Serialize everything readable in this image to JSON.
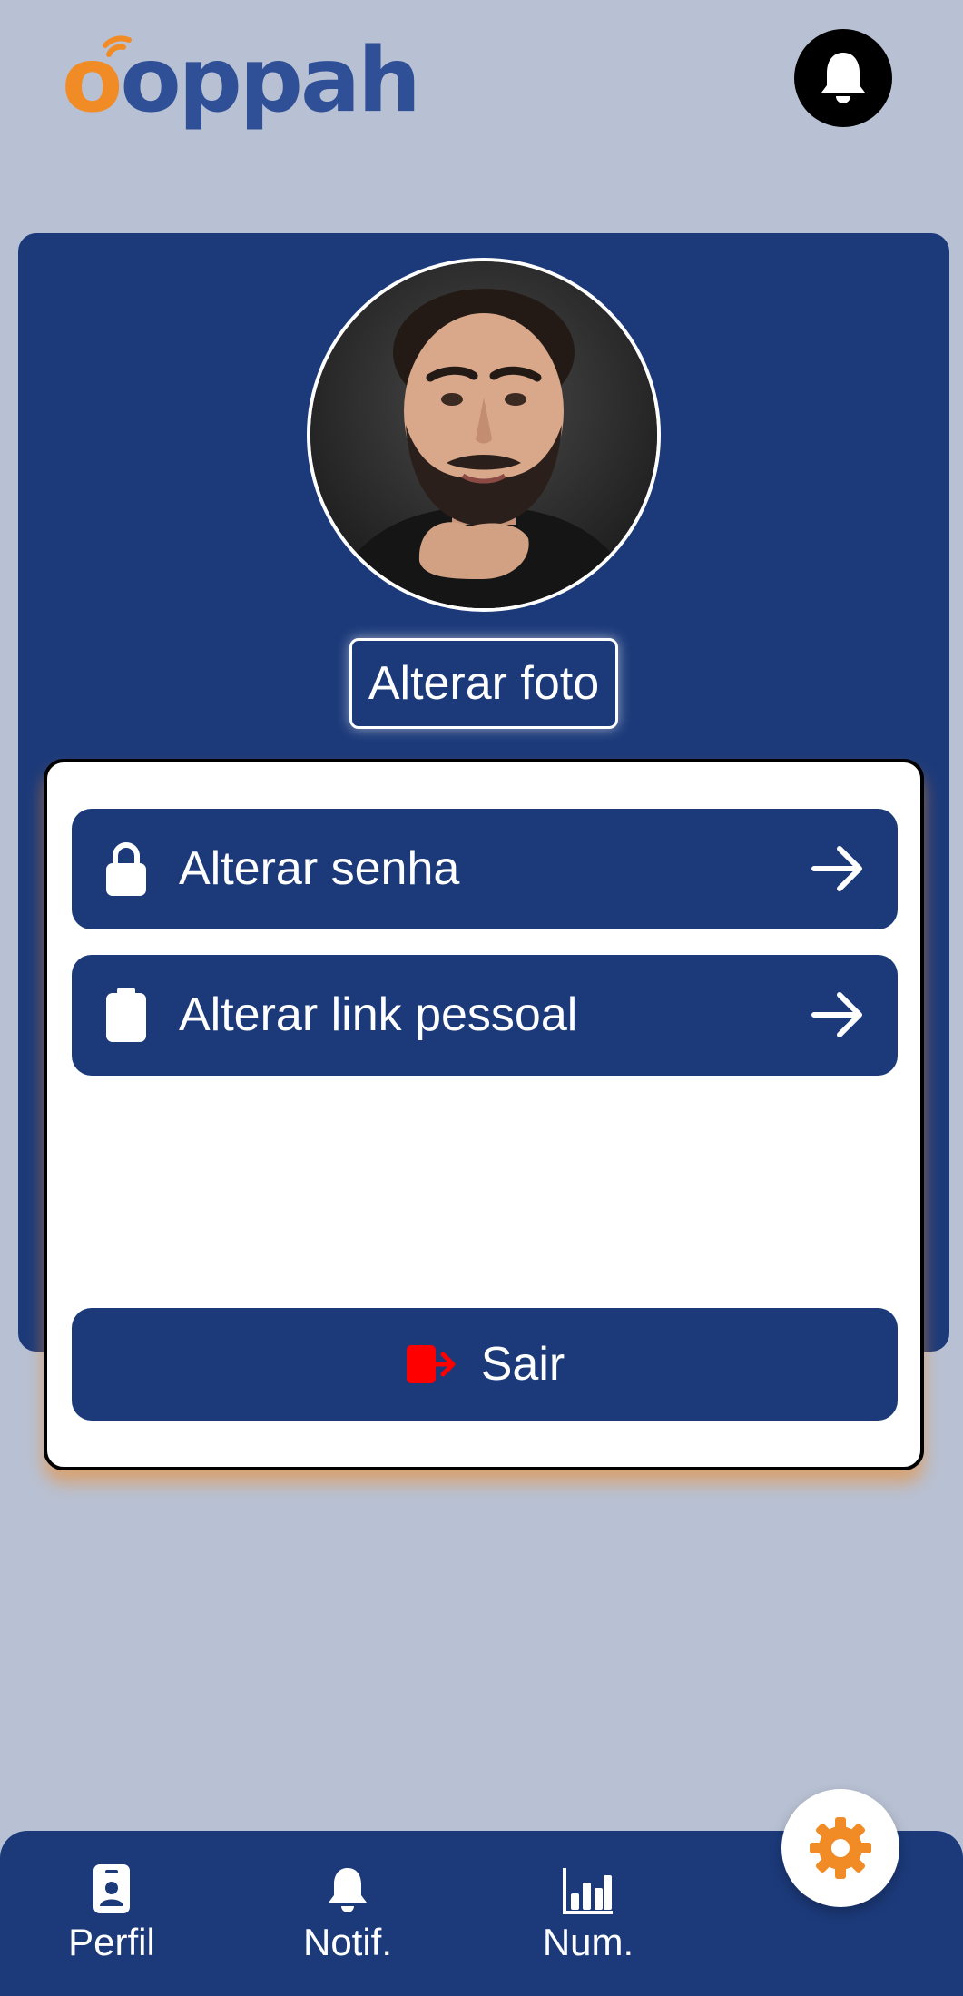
{
  "brand": {
    "logo_text_o": "o",
    "logo_text_rest": "oppah",
    "primary_color": "#1c3a7a",
    "accent_color": "#f08b26",
    "logo_blue": "#2f4f97"
  },
  "header": {
    "notification_icon": "bell-icon"
  },
  "profile": {
    "avatar_alt": "Profile photo",
    "change_photo_label": "Alterar foto"
  },
  "settings_menu": {
    "items": [
      {
        "label": "Alterar senha",
        "icon": "lock-icon",
        "trailing_icon": "arrow-right-icon"
      },
      {
        "label": "Alterar link pessoal",
        "icon": "clipboard-icon",
        "trailing_icon": "arrow-right-icon"
      }
    ],
    "logout_label": "Sair",
    "logout_icon": "logout-icon",
    "logout_icon_color": "#ff0000"
  },
  "bottom_nav": {
    "items": [
      {
        "label": "Perfil",
        "icon": "id-badge-icon"
      },
      {
        "label": "Notif.",
        "icon": "bell-icon"
      },
      {
        "label": "Num.",
        "icon": "bar-chart-icon"
      }
    ],
    "fab_icon": "gear-icon"
  }
}
